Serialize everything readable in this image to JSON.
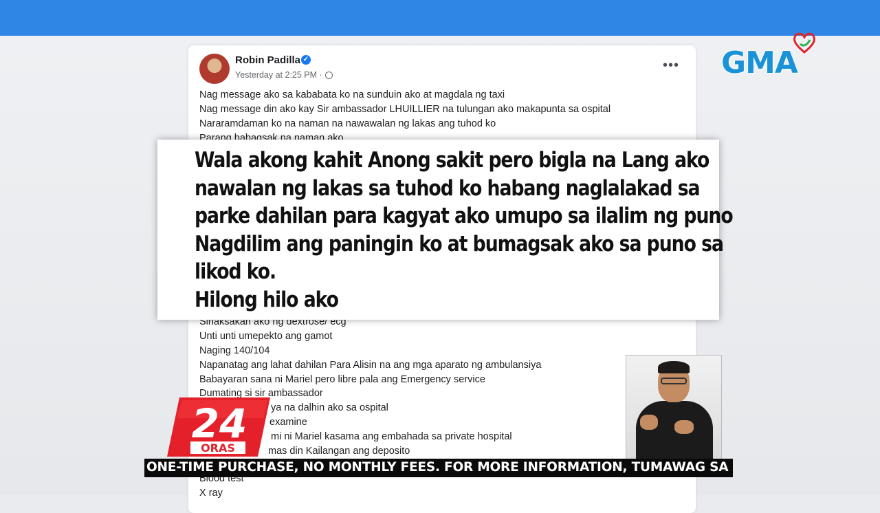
{
  "post": {
    "author": "Robin Padilla",
    "timestamp": "Yesterday at 2:25 PM ·",
    "lines_top": [
      "Nag message ako sa kababata ko na sunduin ako at magdala ng taxi",
      "Nag message din ako kay Sir ambassador LHUILLIER na tulungan ako makapunta sa ospital",
      "Nararamdaman ko na naman na nawawalan ng lakas ang tuhod ko",
      "Parang babagsak na naman ako"
    ],
    "lines_bottom": [
      "Sinaksakan ako ng dextrose/ ecg",
      "Unti unti umepekto ang gamot",
      "Naging 140/104",
      "Napanatag ang lahat dahilan Para Alisin na ang mga aparato ng ambulansiya",
      "Babayaran sana ni Mariel pero libre pala ang Emergency service",
      "Dumating si sir ambassador",
      "ya na dalhin ako sa ospital",
      "examine",
      "mi ni Mariel kasama ang embahada sa private hospital",
      "mas din Kailangan ang deposito",
      "Blood test",
      "X ray"
    ]
  },
  "quote": {
    "lines": [
      "Wala akong kahit Anong sakit pero bigla na Lang ako",
      "nawalan ng lakas sa tuhod ko habang naglalakad sa",
      "parke dahilan para kagyat ako umupo sa ilalim ng puno",
      "Nagdilim ang paningin ko at bumagsak ako sa puno sa",
      "likod ko.",
      "Hilong hilo ako"
    ]
  },
  "logo": {
    "network": "GMA",
    "show_number": "24",
    "show_name": "ORAS"
  },
  "ticker": {
    "text": "ONE-TIME PURCHASE, NO MONTHLY FEES. FOR MORE INFORMATION, TUMAWAG SA HOTLINE NUMBER"
  },
  "colors": {
    "topbar": "#2f86e4",
    "gma_blue": "#1a93d6",
    "oras_red": "#e4202a",
    "ticker_bg": "#0a0a0a"
  }
}
